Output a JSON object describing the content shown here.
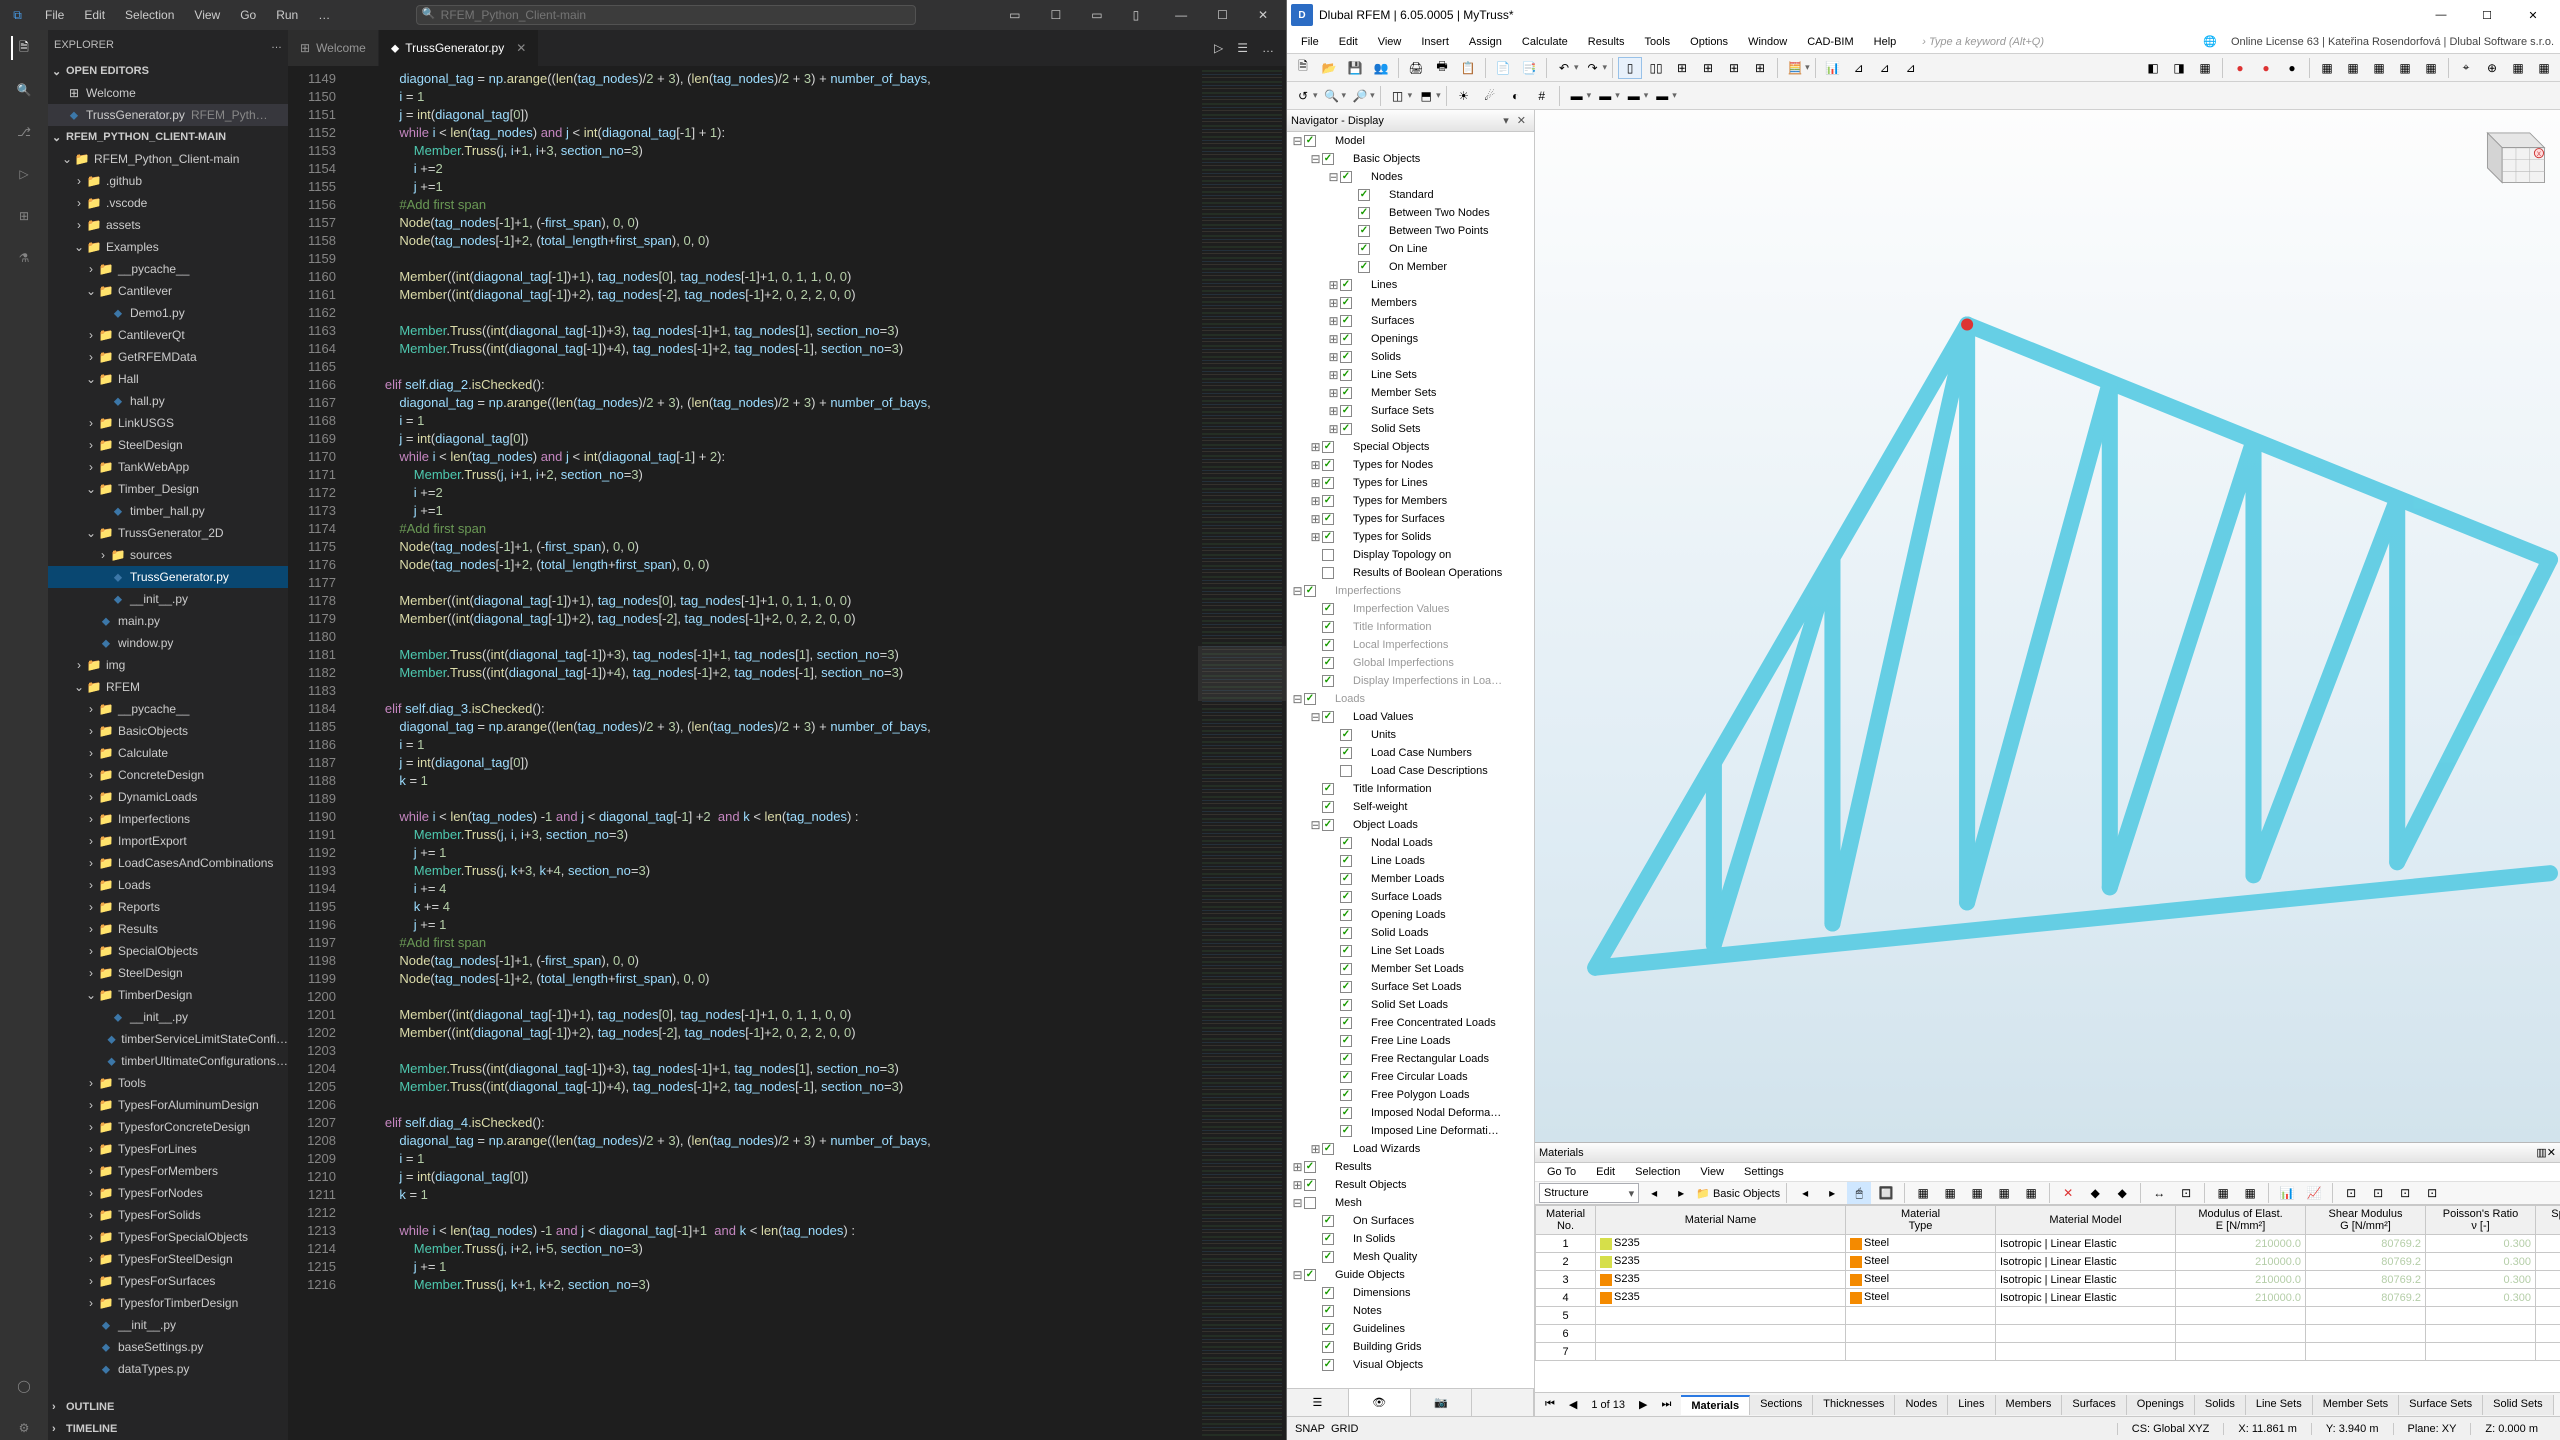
{
  "vscode": {
    "menu": [
      "File",
      "Edit",
      "Selection",
      "View",
      "Go",
      "Run",
      "…"
    ],
    "search_placeholder": "RFEM_Python_Client-main",
    "explorer_title": "EXPLORER",
    "open_editors": {
      "title": "OPEN EDITORS",
      "items": [
        {
          "name": "Welcome",
          "kind": "welcome"
        },
        {
          "name": "TrussGenerator.py",
          "hint": "RFEM_Pyth…",
          "kind": "py",
          "active": true
        }
      ]
    },
    "project_root": "RFEM_PYTHON_CLIENT-MAIN",
    "tree": [
      {
        "l": 1,
        "n": "RFEM_Python_Client-main",
        "t": "folder",
        "open": true
      },
      {
        "l": 2,
        "n": ".github",
        "t": "folder"
      },
      {
        "l": 2,
        "n": ".vscode",
        "t": "folder"
      },
      {
        "l": 2,
        "n": "assets",
        "t": "folder"
      },
      {
        "l": 2,
        "n": "Examples",
        "t": "folder",
        "open": true
      },
      {
        "l": 3,
        "n": "__pycache__",
        "t": "folder"
      },
      {
        "l": 3,
        "n": "Cantilever",
        "t": "folder",
        "open": true
      },
      {
        "l": 4,
        "n": "Demo1.py",
        "t": "py"
      },
      {
        "l": 3,
        "n": "CantileverQt",
        "t": "folder"
      },
      {
        "l": 3,
        "n": "GetRFEMData",
        "t": "folder"
      },
      {
        "l": 3,
        "n": "Hall",
        "t": "folder",
        "open": true
      },
      {
        "l": 4,
        "n": "hall.py",
        "t": "py"
      },
      {
        "l": 3,
        "n": "LinkUSGS",
        "t": "folder"
      },
      {
        "l": 3,
        "n": "SteelDesign",
        "t": "folder"
      },
      {
        "l": 3,
        "n": "TankWebApp",
        "t": "folder"
      },
      {
        "l": 3,
        "n": "Timber_Design",
        "t": "folder",
        "open": true
      },
      {
        "l": 4,
        "n": "timber_hall.py",
        "t": "py"
      },
      {
        "l": 3,
        "n": "TrussGenerator_2D",
        "t": "folder",
        "open": true
      },
      {
        "l": 4,
        "n": "sources",
        "t": "folder"
      },
      {
        "l": 4,
        "n": "TrussGenerator.py",
        "t": "py",
        "sel": true
      },
      {
        "l": 4,
        "n": "__init__.py",
        "t": "py"
      },
      {
        "l": 3,
        "n": "main.py",
        "t": "py"
      },
      {
        "l": 3,
        "n": "window.py",
        "t": "py"
      },
      {
        "l": 2,
        "n": "img",
        "t": "folder"
      },
      {
        "l": 2,
        "n": "RFEM",
        "t": "folder",
        "open": true
      },
      {
        "l": 3,
        "n": "__pycache__",
        "t": "folder"
      },
      {
        "l": 3,
        "n": "BasicObjects",
        "t": "folder"
      },
      {
        "l": 3,
        "n": "Calculate",
        "t": "folder"
      },
      {
        "l": 3,
        "n": "ConcreteDesign",
        "t": "folder"
      },
      {
        "l": 3,
        "n": "DynamicLoads",
        "t": "folder"
      },
      {
        "l": 3,
        "n": "Imperfections",
        "t": "folder"
      },
      {
        "l": 3,
        "n": "ImportExport",
        "t": "folder"
      },
      {
        "l": 3,
        "n": "LoadCasesAndCombinations",
        "t": "folder"
      },
      {
        "l": 3,
        "n": "Loads",
        "t": "folder"
      },
      {
        "l": 3,
        "n": "Reports",
        "t": "folder"
      },
      {
        "l": 3,
        "n": "Results",
        "t": "folder"
      },
      {
        "l": 3,
        "n": "SpecialObjects",
        "t": "folder"
      },
      {
        "l": 3,
        "n": "SteelDesign",
        "t": "folder"
      },
      {
        "l": 3,
        "n": "TimberDesign",
        "t": "folder",
        "open": true
      },
      {
        "l": 4,
        "n": "__init__.py",
        "t": "py"
      },
      {
        "l": 4,
        "n": "timberServiceLimitStateConfi…",
        "t": "py"
      },
      {
        "l": 4,
        "n": "timberUltimateConfigurations…",
        "t": "py"
      },
      {
        "l": 3,
        "n": "Tools",
        "t": "folder"
      },
      {
        "l": 3,
        "n": "TypesForAluminumDesign",
        "t": "folder"
      },
      {
        "l": 3,
        "n": "TypesforConcreteDesign",
        "t": "folder"
      },
      {
        "l": 3,
        "n": "TypesForLines",
        "t": "folder"
      },
      {
        "l": 3,
        "n": "TypesForMembers",
        "t": "folder"
      },
      {
        "l": 3,
        "n": "TypesForNodes",
        "t": "folder"
      },
      {
        "l": 3,
        "n": "TypesForSolids",
        "t": "folder"
      },
      {
        "l": 3,
        "n": "TypesForSpecialObjects",
        "t": "folder"
      },
      {
        "l": 3,
        "n": "TypesForSteelDesign",
        "t": "folder"
      },
      {
        "l": 3,
        "n": "TypesForSurfaces",
        "t": "folder"
      },
      {
        "l": 3,
        "n": "TypesforTimberDesign",
        "t": "folder"
      },
      {
        "l": 3,
        "n": "__init__.py",
        "t": "py"
      },
      {
        "l": 3,
        "n": "baseSettings.py",
        "t": "py"
      },
      {
        "l": 3,
        "n": "dataTypes.py",
        "t": "py"
      }
    ],
    "outline": "OUTLINE",
    "timeline": "TIMELINE",
    "tabs": [
      {
        "label": "Welcome",
        "active": false,
        "icon": "⊞"
      },
      {
        "label": "TrussGenerator.py",
        "active": true,
        "icon": "⬥"
      }
    ],
    "first_line": 1149
  },
  "rfem": {
    "title": "Dlubal RFEM | 6.05.0005 | MyTruss*",
    "menu": [
      "File",
      "Edit",
      "View",
      "Insert",
      "Assign",
      "Calculate",
      "Results",
      "Tools",
      "Options",
      "Window",
      "CAD-BIM",
      "Help"
    ],
    "menu_hint": "Type a keyword (Alt+Q)",
    "license_info": "Online License 63 | Kateřina Rosendorfová | Dlubal Software s.r.o.",
    "navigator": {
      "title": "Navigator - Display",
      "tree": [
        {
          "l": 0,
          "n": "Model",
          "chk": true,
          "exp": true
        },
        {
          "l": 1,
          "n": "Basic Objects",
          "chk": true,
          "exp": true
        },
        {
          "l": 2,
          "n": "Nodes",
          "chk": true,
          "exp": true
        },
        {
          "l": 3,
          "n": "Standard",
          "chk": true
        },
        {
          "l": 3,
          "n": "Between Two Nodes",
          "chk": true
        },
        {
          "l": 3,
          "n": "Between Two Points",
          "chk": true
        },
        {
          "l": 3,
          "n": "On Line",
          "chk": true
        },
        {
          "l": 3,
          "n": "On Member",
          "chk": true
        },
        {
          "l": 2,
          "n": "Lines",
          "chk": true,
          "col": true
        },
        {
          "l": 2,
          "n": "Members",
          "chk": true,
          "col": true
        },
        {
          "l": 2,
          "n": "Surfaces",
          "chk": true,
          "col": true
        },
        {
          "l": 2,
          "n": "Openings",
          "chk": true,
          "col": true
        },
        {
          "l": 2,
          "n": "Solids",
          "chk": true,
          "col": true
        },
        {
          "l": 2,
          "n": "Line Sets",
          "chk": true,
          "col": true
        },
        {
          "l": 2,
          "n": "Member Sets",
          "chk": true,
          "col": true
        },
        {
          "l": 2,
          "n": "Surface Sets",
          "chk": true,
          "col": true
        },
        {
          "l": 2,
          "n": "Solid Sets",
          "chk": true,
          "col": true
        },
        {
          "l": 1,
          "n": "Special Objects",
          "chk": true,
          "col": true
        },
        {
          "l": 1,
          "n": "Types for Nodes",
          "chk": true,
          "col": true
        },
        {
          "l": 1,
          "n": "Types for Lines",
          "chk": true,
          "col": true
        },
        {
          "l": 1,
          "n": "Types for Members",
          "chk": true,
          "col": true
        },
        {
          "l": 1,
          "n": "Types for Surfaces",
          "chk": true,
          "col": true
        },
        {
          "l": 1,
          "n": "Types for Solids",
          "chk": true,
          "col": true
        },
        {
          "l": 1,
          "n": "Display Topology on",
          "chk": false
        },
        {
          "l": 1,
          "n": "Results of Boolean Operations",
          "chk": false
        },
        {
          "l": 0,
          "n": "Imperfections",
          "chk": true,
          "grey": true,
          "exp": true
        },
        {
          "l": 1,
          "n": "Imperfection Values",
          "chk": true,
          "grey": true
        },
        {
          "l": 1,
          "n": "Title Information",
          "chk": true,
          "grey": true
        },
        {
          "l": 1,
          "n": "Local Imperfections",
          "chk": true,
          "grey": true
        },
        {
          "l": 1,
          "n": "Global Imperfections",
          "chk": true,
          "grey": true
        },
        {
          "l": 1,
          "n": "Display Imperfections in Loa…",
          "chk": true,
          "grey": true
        },
        {
          "l": 0,
          "n": "Loads",
          "chk": true,
          "grey": true,
          "exp": true
        },
        {
          "l": 1,
          "n": "Load Values",
          "chk": true,
          "exp": true
        },
        {
          "l": 2,
          "n": "Units",
          "chk": true
        },
        {
          "l": 2,
          "n": "Load Case Numbers",
          "chk": true
        },
        {
          "l": 2,
          "n": "Load Case Descriptions",
          "chk": false
        },
        {
          "l": 1,
          "n": "Title Information",
          "chk": true
        },
        {
          "l": 1,
          "n": "Self-weight",
          "chk": true
        },
        {
          "l": 1,
          "n": "Object Loads",
          "chk": true,
          "exp": true
        },
        {
          "l": 2,
          "n": "Nodal Loads",
          "chk": true
        },
        {
          "l": 2,
          "n": "Line Loads",
          "chk": true
        },
        {
          "l": 2,
          "n": "Member Loads",
          "chk": true
        },
        {
          "l": 2,
          "n": "Surface Loads",
          "chk": true
        },
        {
          "l": 2,
          "n": "Opening Loads",
          "chk": true
        },
        {
          "l": 2,
          "n": "Solid Loads",
          "chk": true
        },
        {
          "l": 2,
          "n": "Line Set Loads",
          "chk": true
        },
        {
          "l": 2,
          "n": "Member Set Loads",
          "chk": true
        },
        {
          "l": 2,
          "n": "Surface Set Loads",
          "chk": true
        },
        {
          "l": 2,
          "n": "Solid Set Loads",
          "chk": true
        },
        {
          "l": 2,
          "n": "Free Concentrated Loads",
          "chk": true
        },
        {
          "l": 2,
          "n": "Free Line Loads",
          "chk": true
        },
        {
          "l": 2,
          "n": "Free Rectangular Loads",
          "chk": true
        },
        {
          "l": 2,
          "n": "Free Circular Loads",
          "chk": true
        },
        {
          "l": 2,
          "n": "Free Polygon Loads",
          "chk": true
        },
        {
          "l": 2,
          "n": "Imposed Nodal Deforma…",
          "chk": true
        },
        {
          "l": 2,
          "n": "Imposed Line Deformati…",
          "chk": true
        },
        {
          "l": 1,
          "n": "Load Wizards",
          "chk": true,
          "col": true
        },
        {
          "l": 0,
          "n": "Results",
          "chk": true,
          "col": true
        },
        {
          "l": 0,
          "n": "Result Objects",
          "chk": true,
          "col": true
        },
        {
          "l": 0,
          "n": "Mesh",
          "chk": false,
          "exp": true
        },
        {
          "l": 1,
          "n": "On Surfaces",
          "chk": true
        },
        {
          "l": 1,
          "n": "In Solids",
          "chk": true
        },
        {
          "l": 1,
          "n": "Mesh Quality",
          "chk": true
        },
        {
          "l": 0,
          "n": "Guide Objects",
          "chk": true,
          "exp": true
        },
        {
          "l": 1,
          "n": "Dimensions",
          "chk": true
        },
        {
          "l": 1,
          "n": "Notes",
          "chk": true
        },
        {
          "l": 1,
          "n": "Guidelines",
          "chk": true
        },
        {
          "l": 1,
          "n": "Building Grids",
          "chk": true
        },
        {
          "l": 1,
          "n": "Visual Objects",
          "chk": true
        }
      ]
    },
    "materials_panel": {
      "title": "Materials",
      "menus": [
        "Go To",
        "Edit",
        "Selection",
        "View",
        "Settings"
      ],
      "structure_combo": "Structure",
      "basic_objects": "Basic Objects",
      "columns": [
        "Material\nNo.",
        "Material Name",
        "Material\nType",
        "Material Model",
        "Modulus of Elast.\nE [N/mm²]",
        "Shear Modulus\nG [N/mm²]",
        "Poisson's Ratio\nν [-]",
        "Specific\nW"
      ],
      "rows": [
        {
          "no": "1",
          "name": "S235",
          "type": "Steel",
          "model": "Isotropic | Linear Elastic",
          "E": "210000.0",
          "G": "80769.2",
          "nu": "0.300",
          "color": "#d6df4a"
        },
        {
          "no": "2",
          "name": "S235",
          "type": "Steel",
          "model": "Isotropic | Linear Elastic",
          "E": "210000.0",
          "G": "80769.2",
          "nu": "0.300",
          "color": "#d6df4a"
        },
        {
          "no": "3",
          "name": "S235",
          "type": "Steel",
          "model": "Isotropic | Linear Elastic",
          "E": "210000.0",
          "G": "80769.2",
          "nu": "0.300",
          "color": "#f48a00"
        },
        {
          "no": "4",
          "name": "S235",
          "type": "Steel",
          "model": "Isotropic | Linear Elastic",
          "E": "210000.0",
          "G": "80769.2",
          "nu": "0.300",
          "color": "#f48a00"
        },
        {
          "no": "5"
        },
        {
          "no": "6"
        },
        {
          "no": "7"
        }
      ],
      "pager": "1 of 13",
      "sheets": [
        "Materials",
        "Sections",
        "Thicknesses",
        "Nodes",
        "Lines",
        "Members",
        "Surfaces",
        "Openings",
        "Solids",
        "Line Sets",
        "Member Sets",
        "Surface Sets",
        "Solid Sets"
      ]
    },
    "status": {
      "cs": "CS: Global XYZ",
      "x": "X: 11.861 m",
      "y": "Y: 3.940 m",
      "plane": "Plane: XY",
      "z": "Z: 0.000 m"
    }
  }
}
